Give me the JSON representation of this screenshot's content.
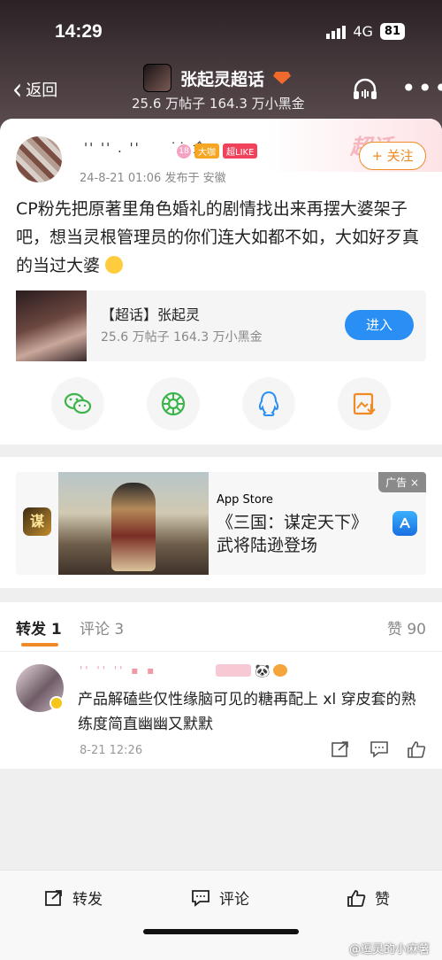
{
  "status": {
    "time": "14:29",
    "network": "4G",
    "battery": "81"
  },
  "header": {
    "back_label": "返回",
    "title": "张起灵超话",
    "subtitle": "25.6 万帖子 164.3 万小黑金"
  },
  "post": {
    "username": " '' '' . ''      ˙˙ 金",
    "level": "18",
    "badge_fan": "大咖",
    "badge_like": "超LIKE",
    "time_location": "24-8-21 01:06  发布于 安徽",
    "follow_label": "+ 关注",
    "text": "CP粉先把原著里角色婚礼的剧情找出来再摆大婆架子吧，想当灵根管理员的你们连大如都不如，大如好歹真的当过大婆",
    "deco_text": "超话"
  },
  "topic": {
    "name": "【超话】张起灵",
    "stats": "25.6 万帖子 164.3 万小黑金",
    "enter_label": "进入"
  },
  "share": [
    "wechat-icon",
    "moments-icon",
    "qq-icon",
    "save-image-icon"
  ],
  "ad": {
    "icon_char": "谋",
    "store": "App Store",
    "title_line1": "《三国：谋定天下》",
    "title_line2": "武将陆逊登场",
    "tag": "广告 ×"
  },
  "tabs": {
    "repost": "转发 1",
    "comment": "评论 3",
    "like": "赞 90"
  },
  "repost_item": {
    "name": "'' '' '' ▪ ▪",
    "text": "产品解磕些仅性缘脑可见的糖再配上 xl 穿皮套的熟练度简直幽幽又默默",
    "time": "8-21 12:26"
  },
  "bottom": {
    "repost": "转发",
    "comment": "评论",
    "like": "赞",
    "watermark": "@逗灵的小麻薯"
  },
  "colors": {
    "accent": "#f08a24",
    "blue": "#2a8ff5",
    "header": "#3a2f32"
  }
}
